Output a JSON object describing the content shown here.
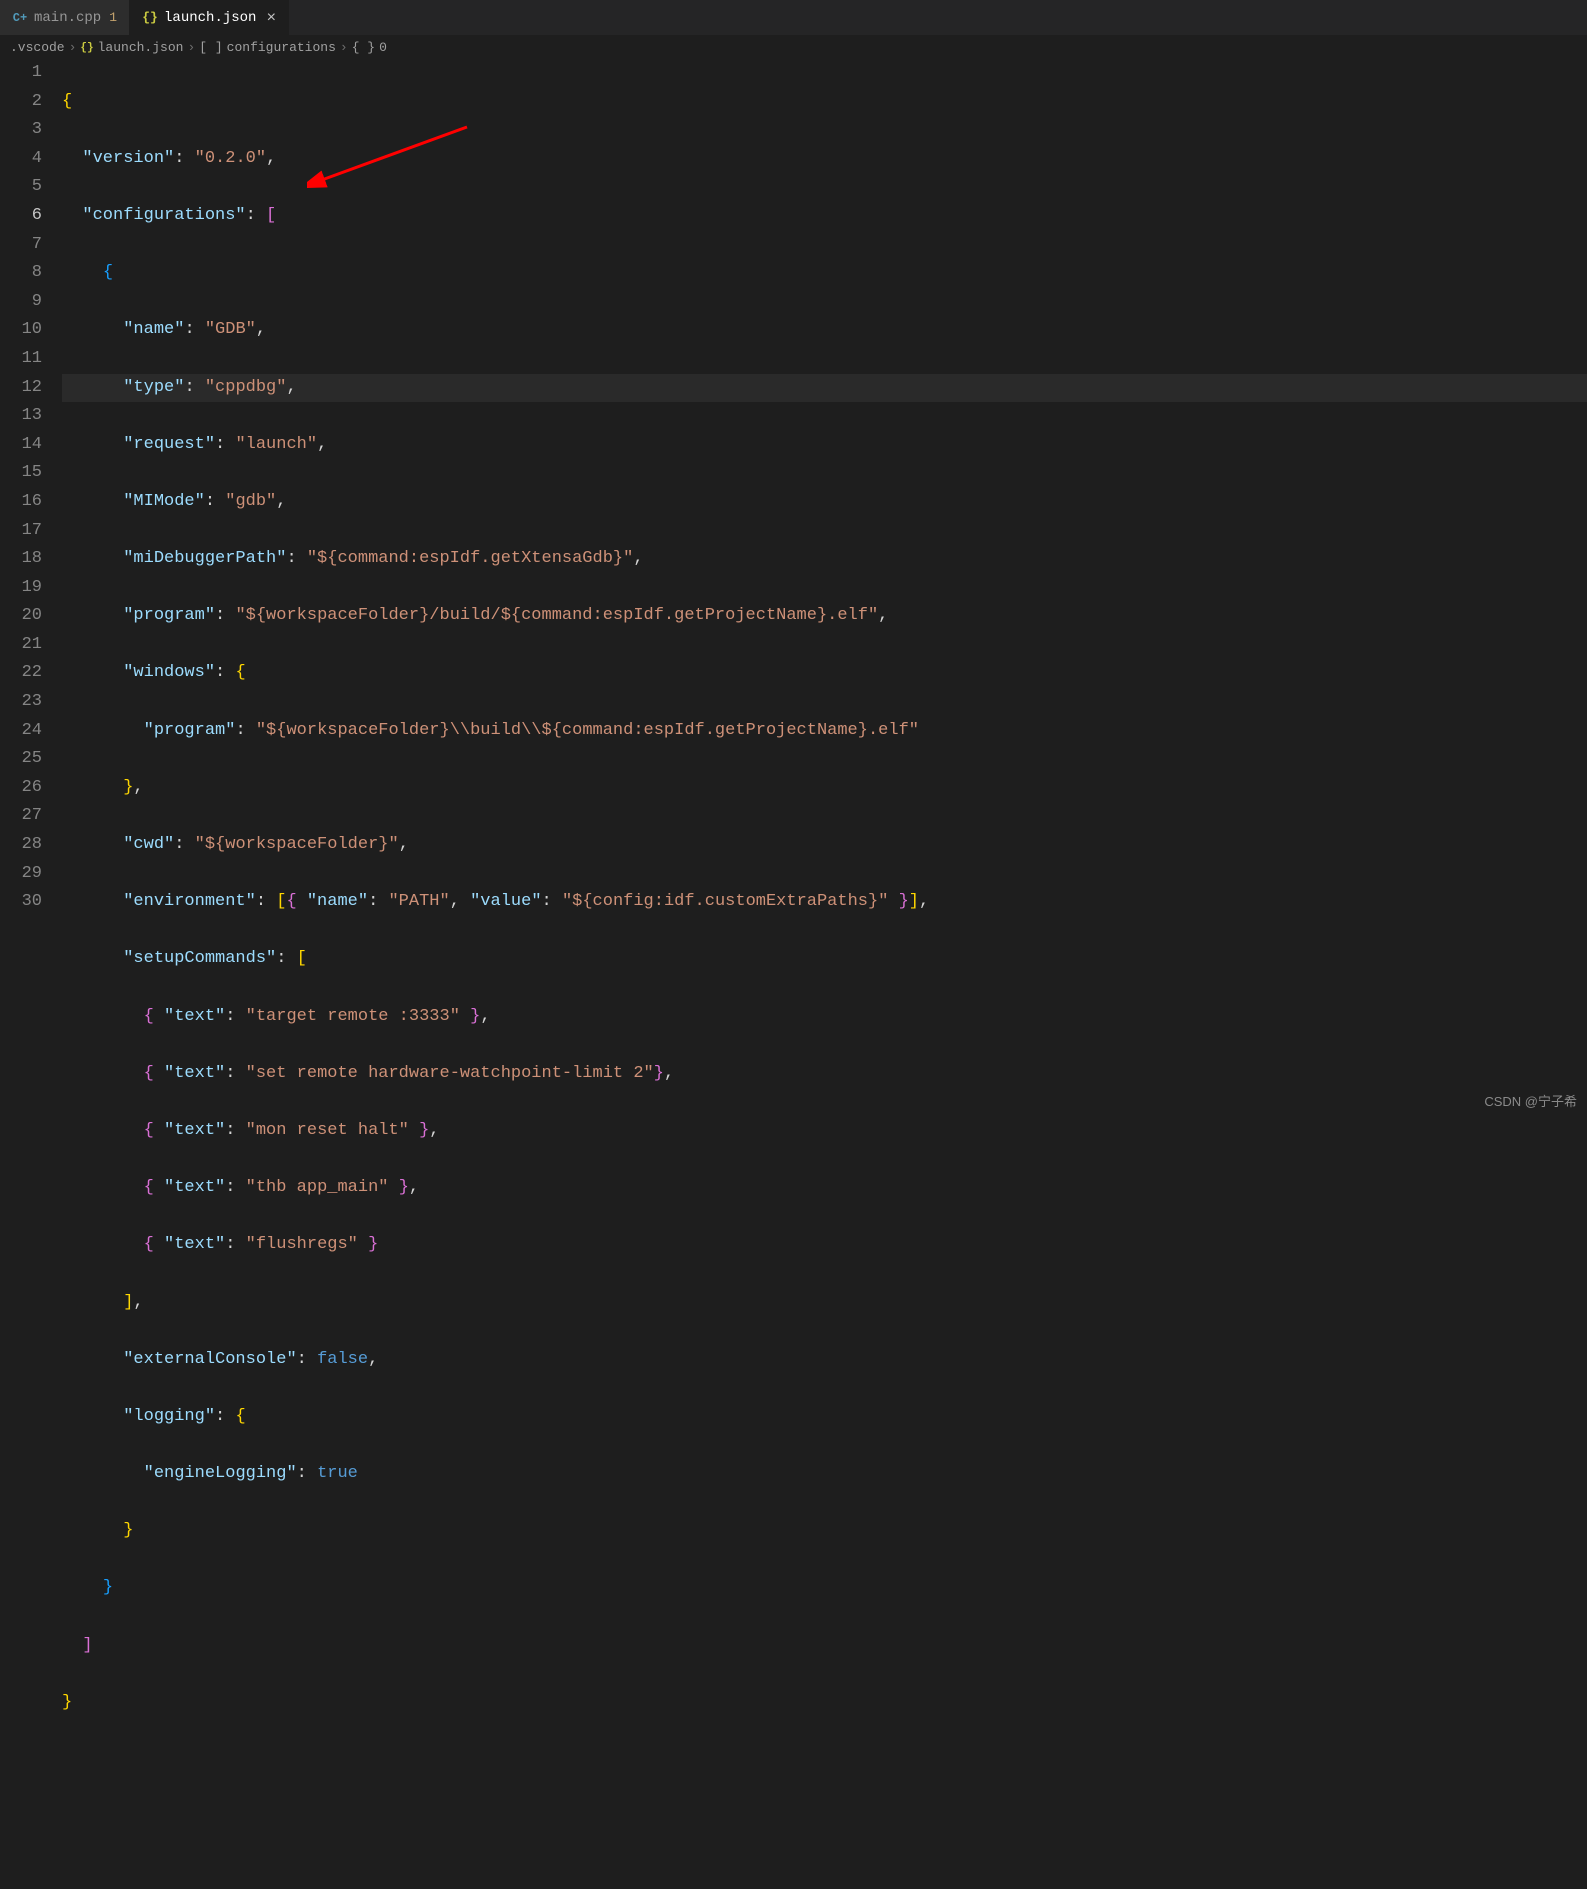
{
  "tabs": [
    {
      "icon": "cpp",
      "label": "main.cpp",
      "dirty": "1",
      "active": false
    },
    {
      "icon": "json",
      "label": "launch.json",
      "active": true,
      "close": "×"
    }
  ],
  "breadcrumb": {
    "seg0": ".vscode",
    "seg1": "launch.json",
    "seg2": "configurations",
    "seg3": "0",
    "bracket_open": "[ ]",
    "brace_open": "{ }"
  },
  "code": {
    "k_version": "\"version\"",
    "v_version": "\"0.2.0\"",
    "k_configurations": "\"configurations\"",
    "k_name": "\"name\"",
    "v_name": "\"GDB\"",
    "k_type": "\"type\"",
    "v_type": "\"cppdbg\"",
    "k_request": "\"request\"",
    "v_request": "\"launch\"",
    "k_mimode": "\"MIMode\"",
    "v_mimode": "\"gdb\"",
    "k_midbg": "\"miDebuggerPath\"",
    "v_midbg": "\"${command:espIdf.getXtensaGdb}\"",
    "k_program": "\"program\"",
    "v_program": "\"${workspaceFolder}/build/${command:espIdf.getProjectName}.elf\"",
    "k_windows": "\"windows\"",
    "k_program2": "\"program\"",
    "v_program2": "\"${workspaceFolder}\\\\build\\\\${command:espIdf.getProjectName}.elf\"",
    "k_cwd": "\"cwd\"",
    "v_cwd": "\"${workspaceFolder}\"",
    "k_env": "\"environment\"",
    "k_env_name": "\"name\"",
    "v_env_name": "\"PATH\"",
    "k_env_value": "\"value\"",
    "v_env_value": "\"${config:idf.customExtraPaths}\"",
    "k_setup": "\"setupCommands\"",
    "k_text": "\"text\"",
    "v_sc1": "\"target remote :3333\"",
    "v_sc2": "\"set remote hardware-watchpoint-limit 2\"",
    "v_sc3": "\"mon reset halt\"",
    "v_sc4": "\"thb app_main\"",
    "v_sc5": "\"flushregs\"",
    "k_ext": "\"externalConsole\"",
    "v_false": "false",
    "k_logging": "\"logging\"",
    "k_engine": "\"engineLogging\"",
    "v_true": "true"
  },
  "lines": [
    "1",
    "2",
    "3",
    "4",
    "5",
    "6",
    "7",
    "8",
    "9",
    "10",
    "11",
    "12",
    "13",
    "14",
    "15",
    "16",
    "17",
    "18",
    "19",
    "20",
    "21",
    "22",
    "23",
    "24",
    "25",
    "26",
    "27",
    "28",
    "29",
    "30"
  ],
  "current_line_index": 5,
  "watermark": "CSDN @宁子希"
}
